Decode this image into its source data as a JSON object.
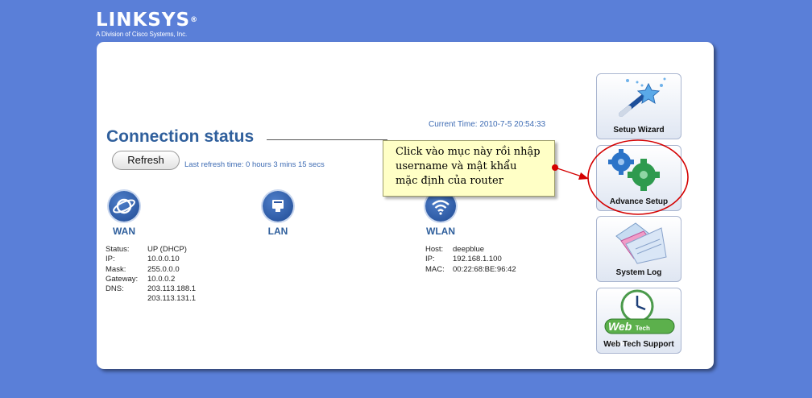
{
  "brand": {
    "name": "LINKSYS",
    "trademark": "®",
    "tagline": "A Division of Cisco Systems, Inc."
  },
  "header": {
    "title": "Connection status",
    "current_time": "Current Time: 2010-7-5 20:54:33"
  },
  "refresh": {
    "button_label": "Refresh",
    "last_refresh": "Last refresh time: 0 hours 3 mins 15 secs"
  },
  "wan": {
    "label": "WAN",
    "status_key": "Status:",
    "status_val": "UP (DHCP)",
    "ip_key": "IP:",
    "ip_val": "10.0.0.10",
    "mask_key": "Mask:",
    "mask_val": "255.0.0.0",
    "gateway_key": "Gateway:",
    "gateway_val": "10.0.0.2",
    "dns_key": "DNS:",
    "dns_val1": "203.113.188.1",
    "dns_val2": "203.113.131.1"
  },
  "lan": {
    "label": "LAN"
  },
  "wlan": {
    "label": "WLAN",
    "host_key": "Host:",
    "host_val": "deepblue",
    "ip_key": "IP:",
    "ip_val": "192.168.1.100",
    "mac_key": "MAC:",
    "mac_val": "00:22:68:BE:96:42"
  },
  "callout": {
    "line1": "Click vào mục này rồi nhập",
    "line2": "username và mật khẩu",
    "line3": "mặc định của router"
  },
  "sidebar": {
    "setup_wizard": "Setup Wizard",
    "advance_setup": "Advance Setup",
    "system_log": "System Log",
    "web_tech_support": "Web Tech Support",
    "web_tech_badge_big": "Web",
    "web_tech_badge_small": "Tech Support"
  },
  "colors": {
    "background": "#5a7fd8",
    "heading": "#2f5f9c",
    "link_text": "#3d6bb3",
    "annotation_red": "#d40000",
    "callout_bg": "#ffffc6"
  }
}
